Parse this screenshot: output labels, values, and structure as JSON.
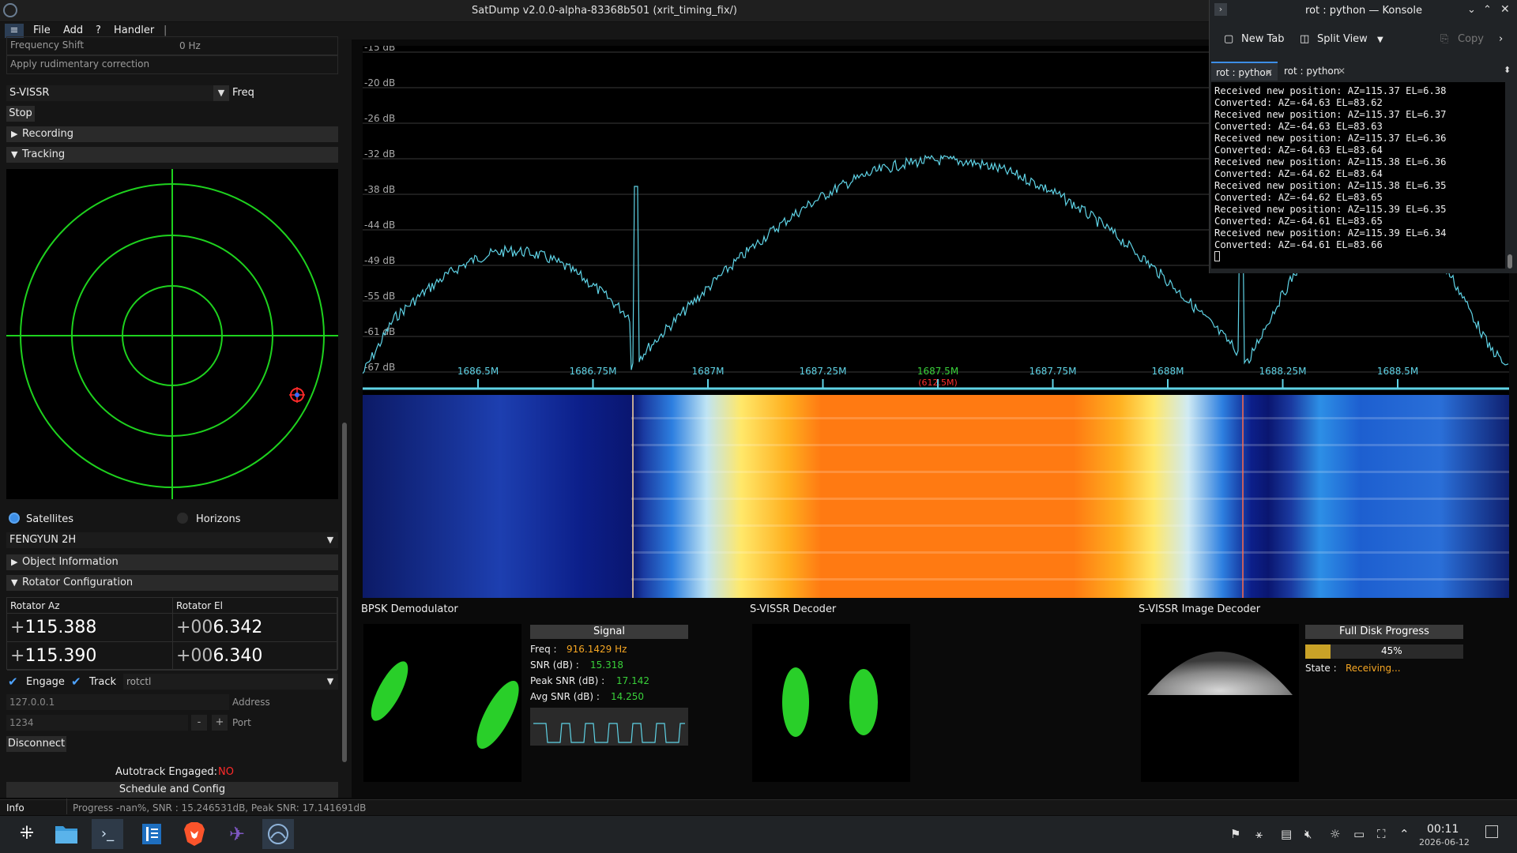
{
  "window": {
    "title": "SatDump v2.0.0-alpha-83368b501 (xrit_timing_fix/)"
  },
  "menu": {
    "file": "File",
    "add": "Add",
    "help": "?",
    "handler": "Handler",
    "sep": "|"
  },
  "left": {
    "freq_shift_label": "Frequency Shift",
    "freq_shift_value": "0 Hz",
    "apply_correction": "Apply rudimentary correction",
    "pipeline": "S-VISSR",
    "freq_label": "Freq",
    "stop_btn": "Stop",
    "recording": "Recording",
    "tracking": "Tracking",
    "satellites_label": "Satellites",
    "horizons_label": "Horizons",
    "satellite": "FENGYUN 2H",
    "object_info": "Object Information",
    "rotator_config": "Rotator Configuration",
    "rot_az_label": "Rotator Az",
    "rot_el_label": "Rotator El",
    "az_target_prefix": "+",
    "az_target": "115.388",
    "el_target_prefix": "+00",
    "el_target": "6.342",
    "az_current_prefix": "+",
    "az_current": "115.390",
    "el_current_prefix": "+00",
    "el_current": "6.340",
    "engage": "Engage",
    "track": "Track",
    "rotator_type": "rotctl",
    "address_value": "127.0.0.1",
    "address_label": "Address",
    "port_value": "1234",
    "port_minus": "-",
    "port_plus": "+",
    "port_label": "Port",
    "disconnect": "Disconnect",
    "autotrack_label": "Autotrack Engaged:",
    "autotrack_value": "NO",
    "schedule": "Schedule and Config"
  },
  "spectrum": {
    "db_labels": [
      "-15 dB",
      "-20 dB",
      "-26 dB",
      "-32 dB",
      "-38 dB",
      "-44 dB",
      "-49 dB",
      "-55 dB",
      "-61 dB",
      "-67 dB"
    ],
    "freq_labels": [
      "1686.5M",
      "1686.75M",
      "1687M",
      "1687.25M",
      "1687.5M",
      "1687.75M",
      "1688M",
      "1688.25M",
      "1688.5M"
    ],
    "center_offset": "(612.5M)",
    "center_color": "#39d13a",
    "line_color": "#5fd3e6"
  },
  "bpsk": {
    "title": "BPSK Demodulator",
    "signal_header": "Signal",
    "freq_label": "Freq :",
    "freq_value": "916.1429 Hz",
    "snr_label": "SNR (dB) :",
    "snr_value": "15.318",
    "peak_label": "Peak SNR (dB) :",
    "peak_value": "17.142",
    "avg_label": "Avg SNR (dB) :",
    "avg_value": "14.250"
  },
  "decoder": {
    "title": "S-VISSR Decoder"
  },
  "image_decoder": {
    "title": "S-VISSR Image Decoder",
    "progress_header": "Full Disk Progress",
    "progress_text": "45%",
    "progress_value": 0.45,
    "state_label": "State :",
    "state_value": "Receiving..."
  },
  "status": {
    "info": "Info",
    "message": "Progress -nan%, SNR : 15.246531dB, Peak SNR: 17.141691dB"
  },
  "konsole": {
    "title": "rot : python — Konsole",
    "new_tab": "New Tab",
    "split_view": "Split View",
    "copy": "Copy",
    "tab1": "rot : python",
    "tab2": "rot : python",
    "lines": [
      "Received new position: AZ=115.37 EL=6.38",
      "Converted: AZ=-64.63 EL=83.62",
      "Received new position: AZ=115.37 EL=6.37",
      "Converted: AZ=-64.63 EL=83.63",
      "Received new position: AZ=115.37 EL=6.36",
      "Converted: AZ=-64.63 EL=83.64",
      "Received new position: AZ=115.38 EL=6.36",
      "Converted: AZ=-64.62 EL=83.64",
      "Received new position: AZ=115.38 EL=6.35",
      "Converted: AZ=-64.62 EL=83.65",
      "Received new position: AZ=115.39 EL=6.35",
      "Converted: AZ=-64.61 EL=83.65",
      "Received new position: AZ=115.39 EL=6.34",
      "Converted: AZ=-64.61 EL=83.66"
    ]
  },
  "taskbar": {
    "icons": [
      "app-launcher-icon",
      "file-manager-icon",
      "terminal-icon",
      "text-editor-icon",
      "brave-browser-icon",
      "satellite-app-icon",
      "satdump-icon"
    ],
    "time": "00:11",
    "date": "2026-06-12"
  }
}
